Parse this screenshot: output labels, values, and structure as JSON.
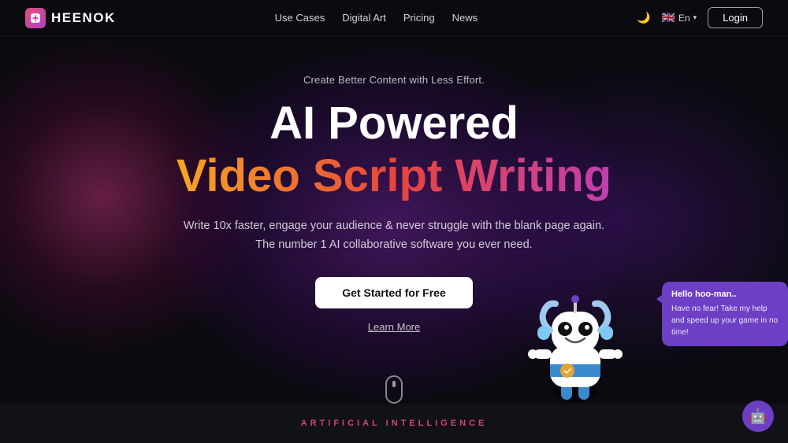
{
  "brand": {
    "logo_icon": "🤖",
    "logo_text": "HEENOK"
  },
  "navbar": {
    "links": [
      {
        "label": "Use Cases",
        "id": "use-cases"
      },
      {
        "label": "Digital Art",
        "id": "digital-art"
      },
      {
        "label": "Pricing",
        "id": "pricing"
      },
      {
        "label": "News",
        "id": "news"
      }
    ],
    "lang_flag": "🇬🇧",
    "lang_code": "En",
    "login_label": "Login",
    "moon_icon": "🌙"
  },
  "hero": {
    "subtitle": "Create Better Content with Less Effort.",
    "title_line1": "AI Powered",
    "title_line2": "Video Script Writing",
    "description_line1": "Write 10x faster, engage your audience & never struggle with the blank page again.",
    "description_line2": "The number 1 AI collaborative software you ever need.",
    "cta_label": "Get Started for Free",
    "learn_more_label": "Learn More"
  },
  "chat_bubble": {
    "title": "Hello hoo-man..",
    "text": "Have no fear! Take my help and speed up your game in no time!"
  },
  "bottom": {
    "ai_label": "ARTIFICIAL INTELLIGENCE"
  },
  "chat_widget": {
    "icon": "🤖"
  },
  "colors": {
    "gradient_start": "#f5a623",
    "gradient_mid": "#e8453c",
    "gradient_end": "#c040b0",
    "bubble_bg": "#6c3fc5",
    "ai_label_color": "#d4456a"
  }
}
